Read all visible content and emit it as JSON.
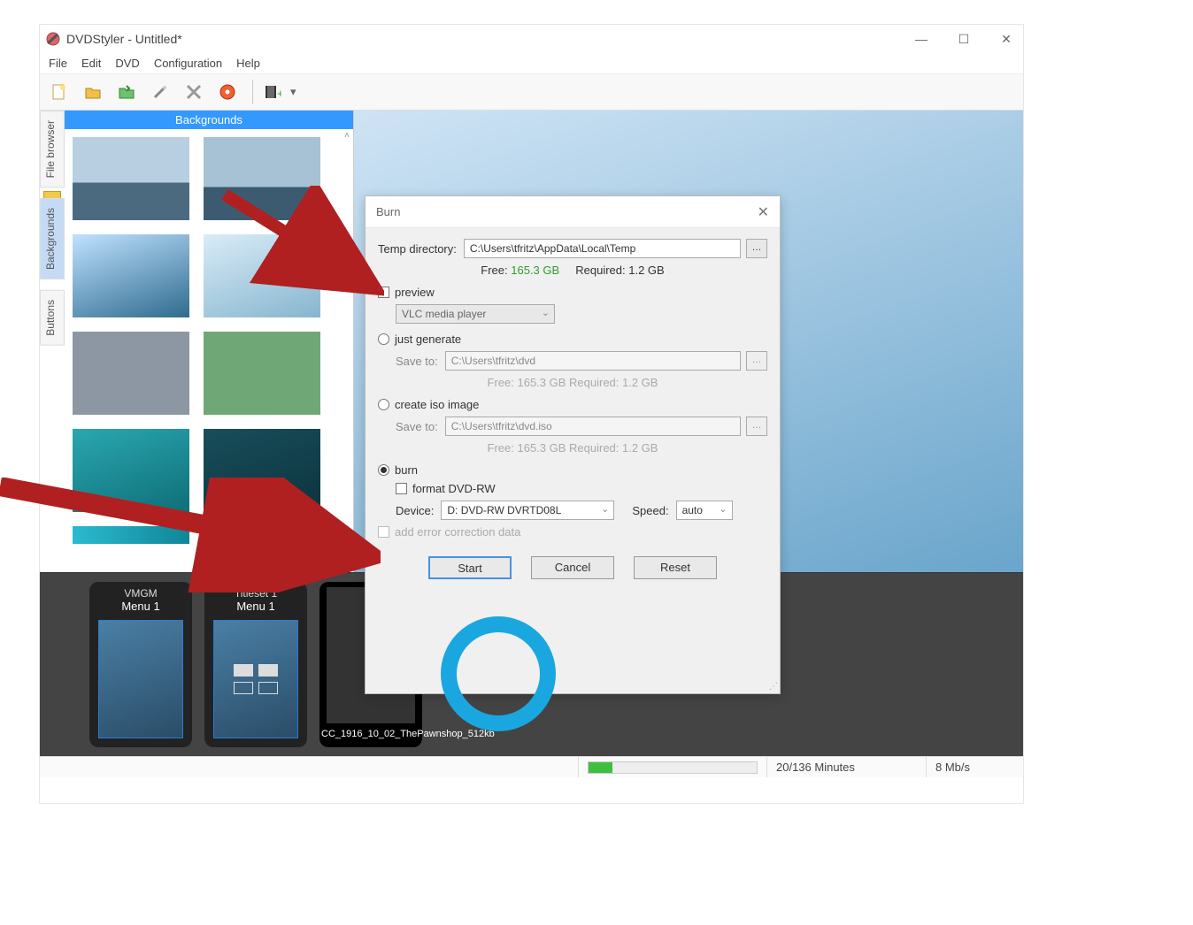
{
  "app": {
    "title": "DVDStyler - Untitled*"
  },
  "menu": {
    "file": "File",
    "edit": "Edit",
    "dvd": "DVD",
    "config": "Configuration",
    "help": "Help"
  },
  "side_tabs": {
    "file_browser": "File browser",
    "backgrounds": "Backgrounds",
    "buttons": "Buttons"
  },
  "sidebar": {
    "heading": "Backgrounds"
  },
  "timeline": {
    "card1": {
      "set": "VMGM",
      "menu": "Menu 1"
    },
    "card2": {
      "set": "Titleset 1",
      "menu": "Menu 1"
    },
    "clip": {
      "name": "CC_1916_10_02_ThePawnshop_512kb"
    }
  },
  "status": {
    "minutes": "20/136 Minutes",
    "bitrate": "8 Mb/s"
  },
  "dialog": {
    "title": "Burn",
    "temp_label": "Temp directory:",
    "temp_value": "C:\\Users\\tfritz\\AppData\\Local\\Temp",
    "free_label": "Free:",
    "free_value": "165.3 GB",
    "req_label": "Required:",
    "req_value": "1.2 GB",
    "preview_label": "preview",
    "preview_player": "VLC media player",
    "just_generate_label": "just generate",
    "save_to_label": "Save to:",
    "gen_path": "C:\\Users\\tfritz\\dvd",
    "gen_free": "Free: 165.3 GB    Required: 1.2 GB",
    "iso_label": "create iso image",
    "iso_path": "C:\\Users\\tfritz\\dvd.iso",
    "iso_free": "Free: 165.3 GB    Required: 1.2 GB",
    "burn_label": "burn",
    "format_label": "format DVD-RW",
    "device_label": "Device:",
    "device_value": "D: DVD-RW  DVRTD08L",
    "speed_label": "Speed:",
    "speed_value": "auto",
    "add_err_label": "add error correction data",
    "start": "Start",
    "cancel": "Cancel",
    "reset": "Reset"
  }
}
